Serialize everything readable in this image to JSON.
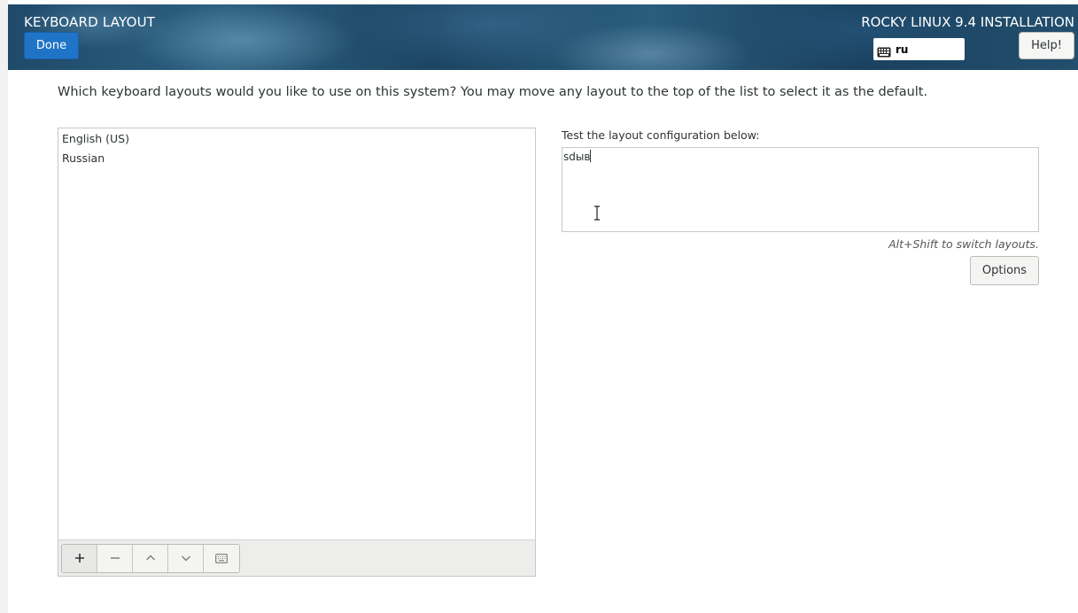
{
  "header": {
    "title": "KEYBOARD LAYOUT",
    "done_label": "Done",
    "installer_title": "ROCKY LINUX 9.4 INSTALLATION",
    "keyboard_indicator": {
      "icon": "keyboard-icon",
      "value": "ru"
    },
    "help_label": "Help!"
  },
  "main": {
    "instructions": "Which keyboard layouts would you like to use on this system?  You may move any layout to the top of the list to select it as the default.",
    "layouts": [
      {
        "label": "English (US)"
      },
      {
        "label": "Russian"
      }
    ],
    "toolbar": {
      "add_icon": "plus-icon",
      "remove_icon": "minus-icon",
      "move_up_icon": "chevron-up-icon",
      "move_down_icon": "chevron-down-icon",
      "preview_icon": "keyboard-icon"
    },
    "test": {
      "label": "Test the layout configuration below:",
      "value": "sdыв"
    },
    "switch_hint": "Alt+Shift to switch layouts.",
    "options_label": "Options"
  },
  "colors": {
    "accent": "#1f74c8",
    "header_bg": "#234f6e"
  }
}
